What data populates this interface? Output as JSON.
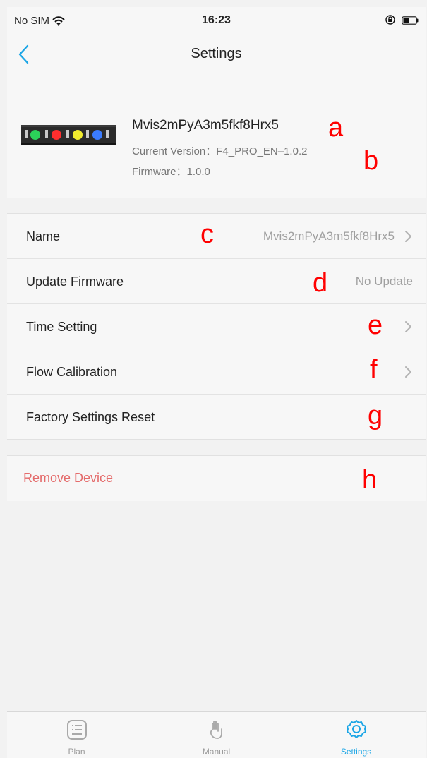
{
  "status_bar": {
    "carrier": "No SIM",
    "time": "16:23",
    "wifi_icon": "wifi-icon",
    "lock_icon": "rotation-lock-icon",
    "battery_icon": "battery-icon"
  },
  "nav": {
    "title": "Settings",
    "back_icon": "chevron-left-icon"
  },
  "device": {
    "name": "Mvis2mPyA3m5fkf8Hrx5",
    "version": "Current Version：F4_PRO_EN–1.0.2",
    "firmware": "Firmware：1.0.0",
    "image_icon": "device-image"
  },
  "menu": {
    "items": [
      {
        "label": "Name",
        "value": "Mvis2mPyA3m5fkf8Hrx5",
        "has_chevron": true
      },
      {
        "label": "Update Firmware",
        "value": "No Update",
        "has_chevron": false
      },
      {
        "label": "Time Setting",
        "value": "",
        "has_chevron": true
      },
      {
        "label": "Flow Calibration",
        "value": "",
        "has_chevron": true
      },
      {
        "label": "Factory Settings Reset",
        "value": "",
        "has_chevron": false
      }
    ]
  },
  "remove": {
    "label": "Remove Device",
    "color": "#e46b6b"
  },
  "annotations": {
    "a": "a",
    "b": "b",
    "c": "c",
    "d": "d",
    "e": "e",
    "f": "f",
    "g": "g",
    "h": "h"
  },
  "tabbar": {
    "tabs": [
      {
        "label": "Plan",
        "icon": "plan-icon"
      },
      {
        "label": "Manual",
        "icon": "manual-icon"
      },
      {
        "label": "Settings",
        "icon": "settings-icon"
      }
    ],
    "active_color": "#1ca6e6",
    "inactive_color": "#9a9a9a"
  }
}
